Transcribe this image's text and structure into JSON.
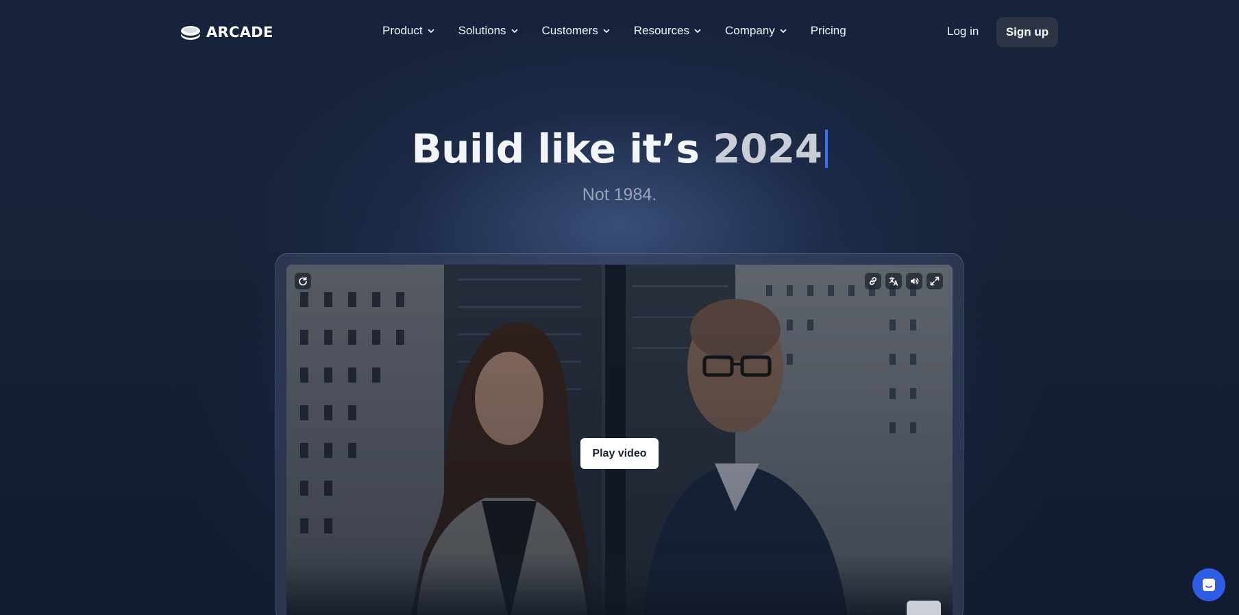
{
  "brand": {
    "name": "ARCADE"
  },
  "nav": {
    "items": [
      {
        "label": "Product",
        "has_dropdown": true
      },
      {
        "label": "Solutions",
        "has_dropdown": true
      },
      {
        "label": "Customers",
        "has_dropdown": true
      },
      {
        "label": "Resources",
        "has_dropdown": true
      },
      {
        "label": "Company",
        "has_dropdown": true
      },
      {
        "label": "Pricing",
        "has_dropdown": false
      }
    ],
    "login_label": "Log in",
    "signup_label": "Sign up"
  },
  "hero": {
    "title_main": "Build like it’s ",
    "title_highlight": "2024",
    "subtitle": "Not 1984."
  },
  "video": {
    "play_label": "Play video",
    "controls": [
      "restart-icon",
      "link-icon",
      "translate-icon",
      "volume-icon",
      "fullscreen-icon"
    ]
  },
  "colors": {
    "accent": "#3b6ff5",
    "signup_bg": "#2c3445",
    "chat_button": "#2f5ee6"
  }
}
